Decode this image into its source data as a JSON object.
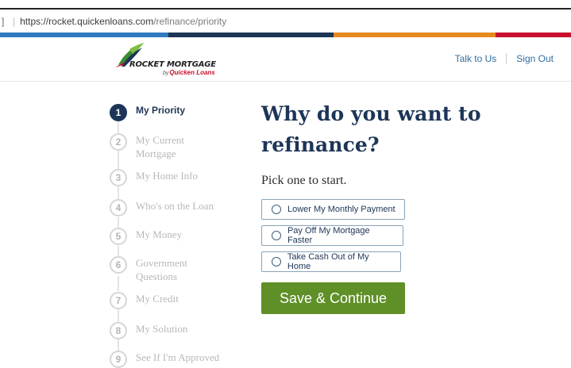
{
  "browser": {
    "left_edge": "]",
    "url_host": "https://rocket.quickenloans.com",
    "url_path": "/refinance/priority"
  },
  "colors": {
    "stripe": [
      "#2f7bc0",
      "#1d3557",
      "#e58a1f",
      "#c8102e"
    ],
    "primary": "#1d3557",
    "cta": "#5f8f27",
    "link": "#2f6d9e"
  },
  "brand": {
    "name": "ROCKET MORTGAGE",
    "by": "by",
    "sub": "Quicken Loans"
  },
  "nav": {
    "talk": "Talk to Us",
    "signout": "Sign Out"
  },
  "steps": [
    {
      "num": "1",
      "label": "My Priority",
      "active": true
    },
    {
      "num": "2",
      "label": "My Current Mortgage"
    },
    {
      "num": "3",
      "label": "My Home Info"
    },
    {
      "num": "4",
      "label": "Who's on the Loan"
    },
    {
      "num": "5",
      "label": "My Money"
    },
    {
      "num": "6",
      "label": "Government Questions"
    },
    {
      "num": "7",
      "label": "My Credit"
    },
    {
      "num": "8",
      "label": "My Solution"
    },
    {
      "num": "9",
      "label": "See If I'm Approved"
    }
  ],
  "main": {
    "title_line1": "Why do you want to",
    "title_line2": "refinance?",
    "subtitle": "Pick one to start.",
    "options": [
      "Lower My Monthly Payment",
      "Pay Off My Mortgage Faster",
      "Take Cash Out of My Home"
    ],
    "cta": "Save & Continue"
  }
}
